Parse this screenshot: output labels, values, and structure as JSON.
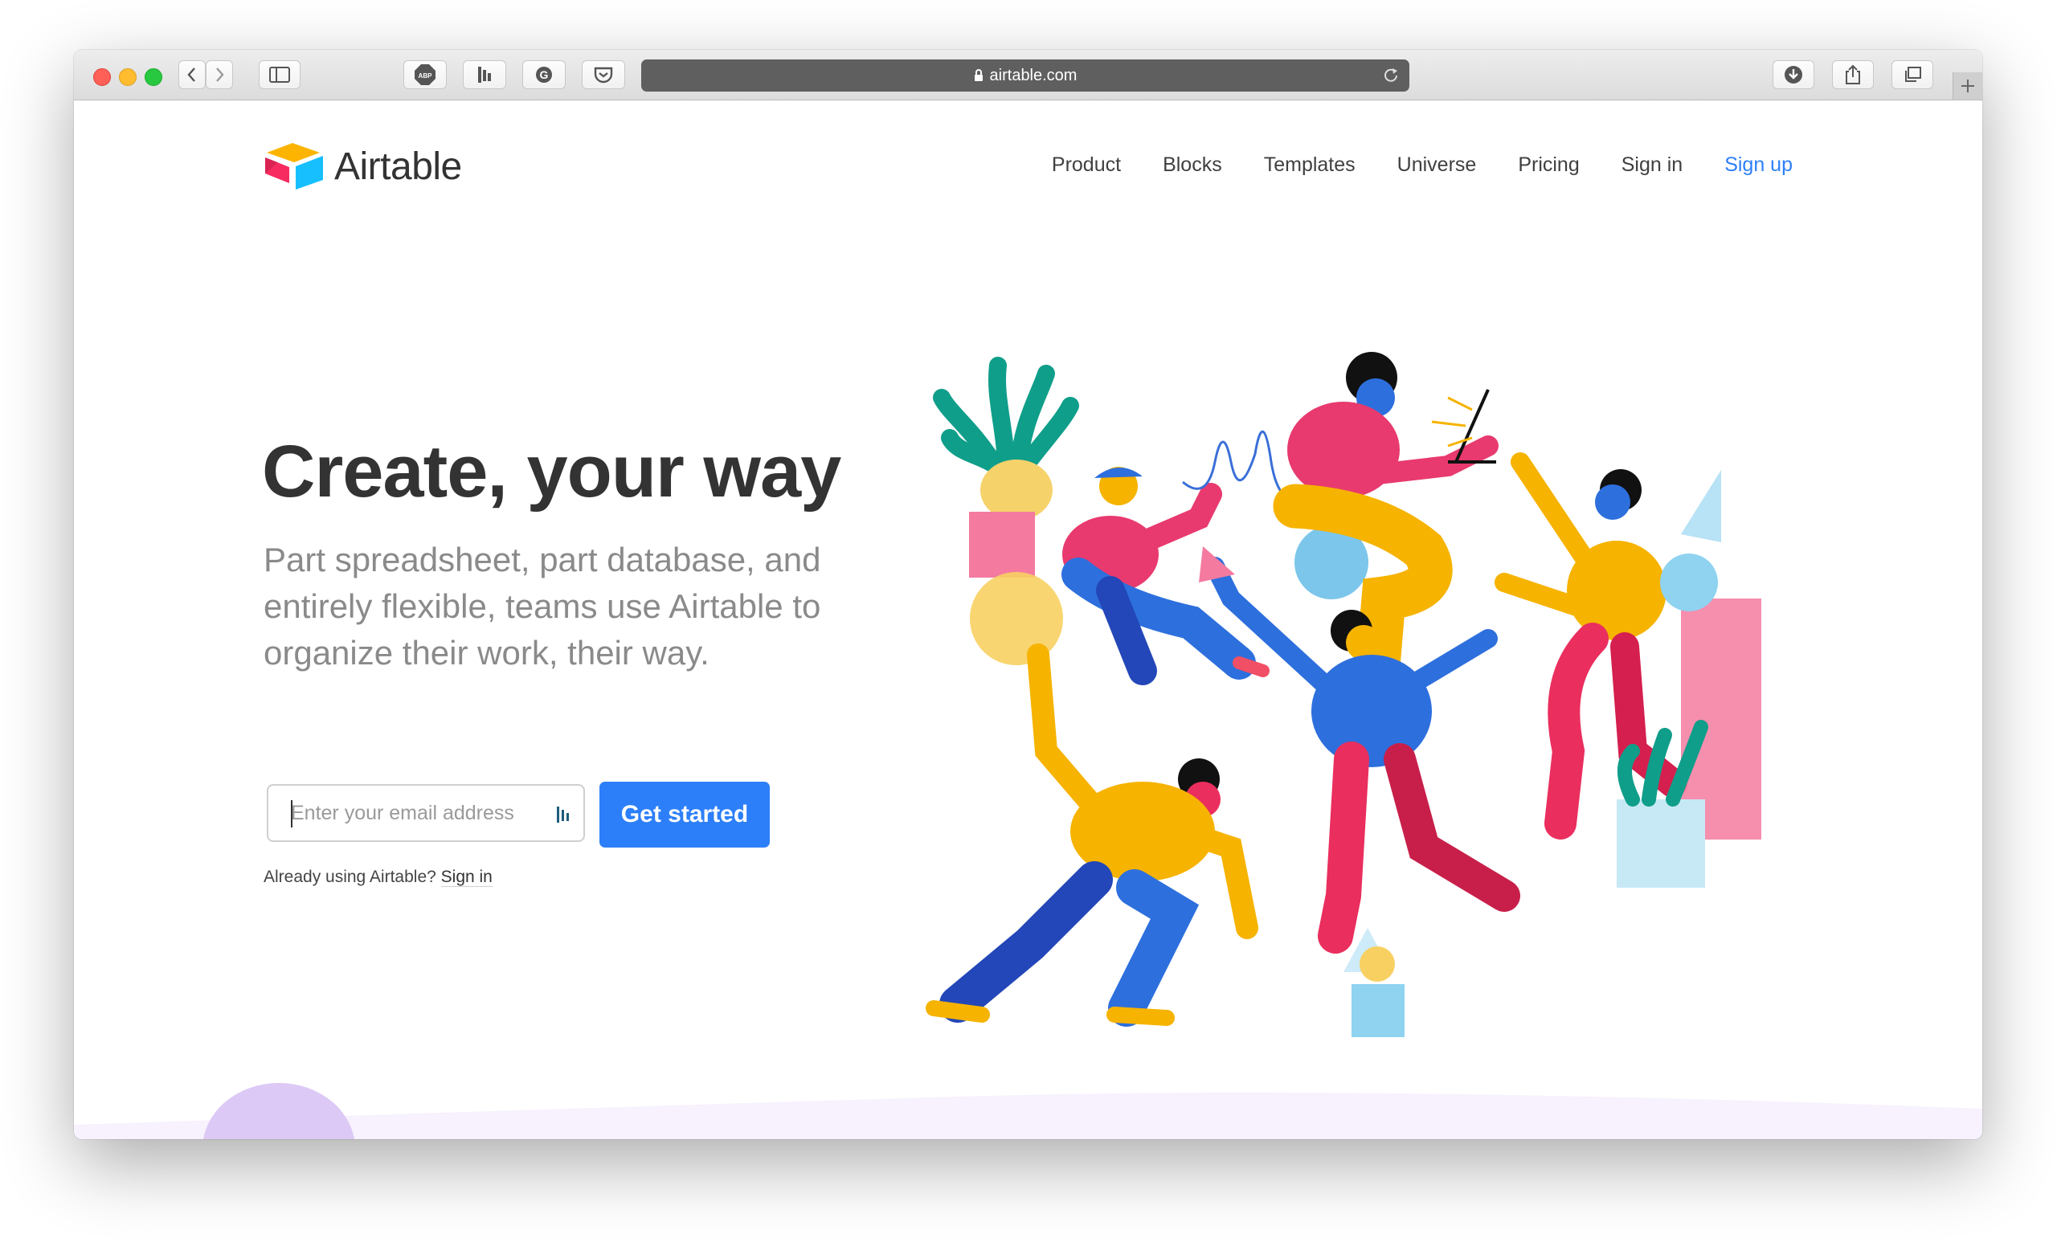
{
  "browser": {
    "url": "airtable.com"
  },
  "brand": {
    "name": "Airtable",
    "colors": {
      "accent": "#2d7ff9",
      "yellow": "#fcb400",
      "pink": "#f82b60",
      "red": "#e8384f",
      "blue": "#2d7ff9"
    }
  },
  "nav": {
    "items": [
      {
        "label": "Product"
      },
      {
        "label": "Blocks"
      },
      {
        "label": "Templates"
      },
      {
        "label": "Universe"
      },
      {
        "label": "Pricing"
      },
      {
        "label": "Sign in"
      },
      {
        "label": "Sign up"
      }
    ]
  },
  "hero": {
    "title": "Create, your way",
    "subtitle": "Part spreadsheet, part database, and entirely flexible, teams use Airtable to organize their work, their way.",
    "email_placeholder": "Enter your email address",
    "cta_label": "Get started",
    "already_text": "Already using Airtable?",
    "signin_link": "Sign in"
  },
  "icons": {
    "toolbar": [
      "back-icon",
      "forward-icon",
      "sidebar-icon",
      "adblock-icon",
      "bookmark-icon",
      "grammarly-icon",
      "pocket-icon",
      "lock-icon",
      "reload-icon",
      "download-icon",
      "share-icon",
      "tabs-icon",
      "plus-icon"
    ]
  }
}
